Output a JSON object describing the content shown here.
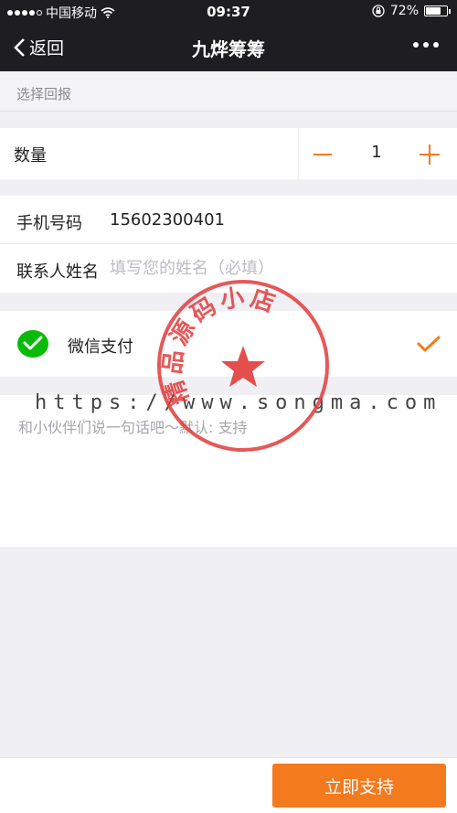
{
  "status_bar": {
    "carrier": "中国移动",
    "time": "09:37",
    "battery_percent": "72%",
    "battery_level": 0.72
  },
  "nav": {
    "back_label": "返回",
    "title": "九烨筹筹"
  },
  "section_header": "选择回报",
  "quantity": {
    "label": "数量",
    "value": "1"
  },
  "form": {
    "phone_label": "手机号码",
    "phone_value": "15602300401",
    "name_label": "联系人姓名",
    "name_placeholder": "填写您的姓名（必填）"
  },
  "payment": {
    "label": "微信支付",
    "selected": true
  },
  "message": {
    "placeholder": "和小伙伴们说一句话吧～默认: 支持"
  },
  "watermark": {
    "url": "https://www.songma.com",
    "stamp_text": "精品源码小店"
  },
  "bottom": {
    "support_button": "立即支持"
  },
  "colors": {
    "accent": "#f47a1e",
    "nav_bg": "#1d1d22",
    "wechat_green": "#09bb07"
  }
}
